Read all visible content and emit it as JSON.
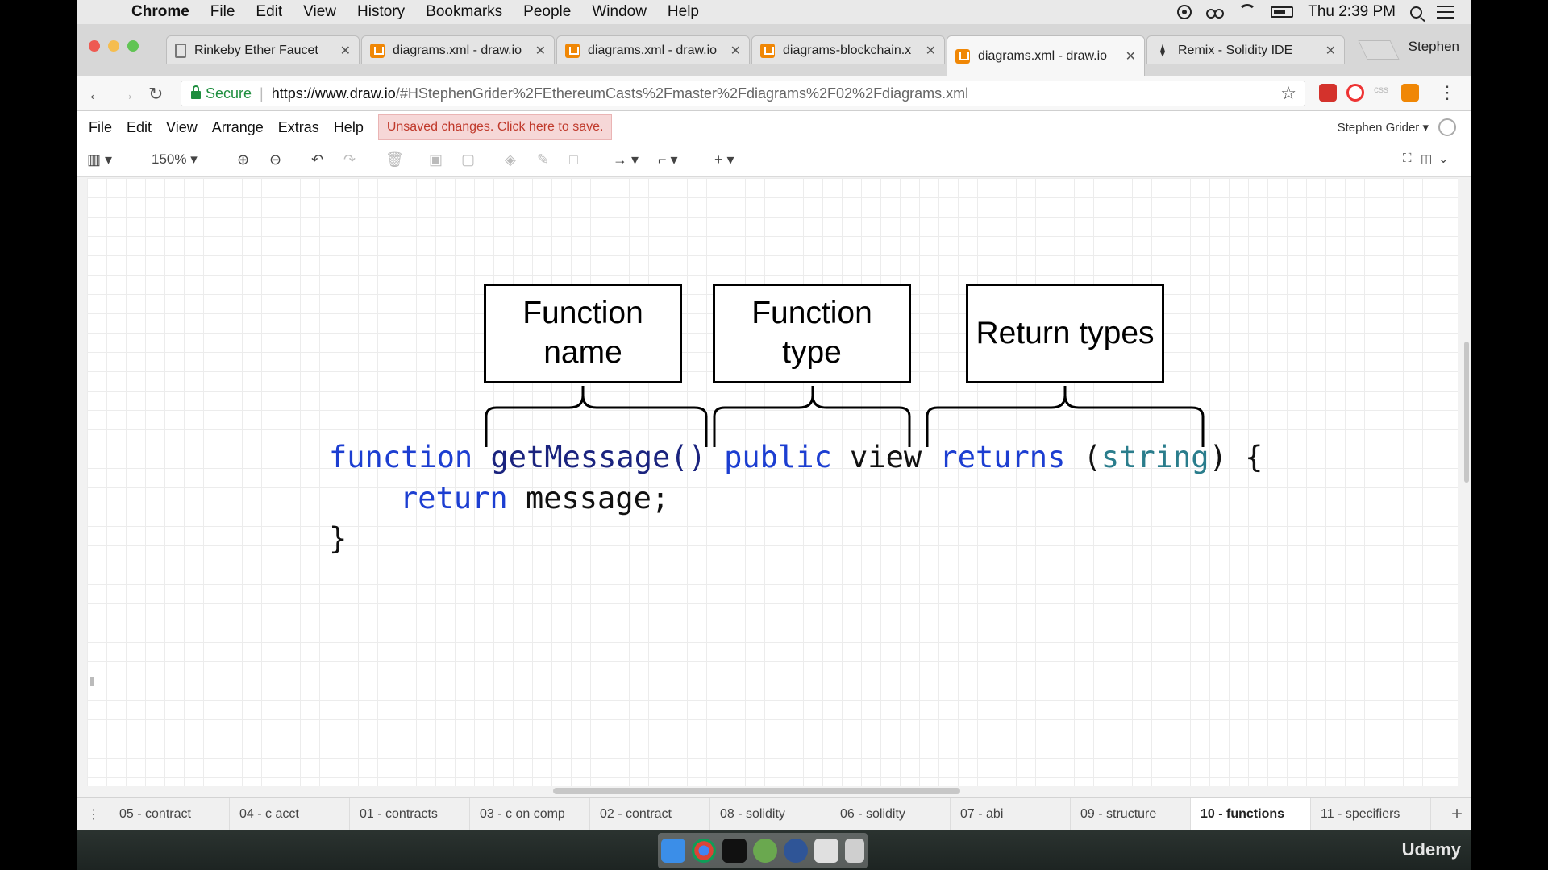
{
  "mac_menubar": {
    "apple_icon": "apple-icon",
    "items": [
      "Chrome",
      "File",
      "Edit",
      "View",
      "History",
      "Bookmarks",
      "People",
      "Window",
      "Help"
    ],
    "clock": "Thu 2:39 PM"
  },
  "browser": {
    "tabs": [
      {
        "label": "Rinkeby Ether Faucet",
        "icon": "document-icon"
      },
      {
        "label": "diagrams.xml - draw.io",
        "icon": "drawio-icon"
      },
      {
        "label": "diagrams.xml - draw.io",
        "icon": "drawio-icon"
      },
      {
        "label": "diagrams-blockchain.x",
        "icon": "drawio-icon"
      },
      {
        "label": "diagrams.xml - draw.io",
        "icon": "drawio-icon",
        "active": true
      },
      {
        "label": "Remix - Solidity IDE",
        "icon": "remix-icon"
      }
    ],
    "profile": "Stephen",
    "secure_label": "Secure",
    "url_host": "https://www.draw.io",
    "url_path": "/#HStephenGrider%2FEthereumCasts%2Fmaster%2Fdiagrams%2F02%2Fdiagrams.xml"
  },
  "drawio": {
    "menu": [
      "File",
      "Edit",
      "View",
      "Arrange",
      "Extras",
      "Help"
    ],
    "unsaved_notice": "Unsaved changes. Click here to save.",
    "user": "Stephen Grider",
    "zoom": "150%",
    "diagram": {
      "boxes": [
        "Function\nname",
        "Function\ntype",
        "Return types"
      ],
      "code": {
        "kw_function": "function",
        "fn_name": "getMessage()",
        "kw_public": "public",
        "kw_view": "view",
        "kw_returns": "returns",
        "paren_open": "(",
        "type_string": "string",
        "paren_close_brace": ") {",
        "kw_return": "return",
        "return_value": "message;",
        "closing_brace": "}"
      }
    },
    "pages": [
      "05 - contract",
      "04 - c acct",
      "01 - contracts",
      "03 - c on comp",
      "02 - contract",
      "08 - solidity",
      "06 - solidity",
      "07 - abi",
      "09 - structure",
      "10 - functions",
      "11 - specifiers"
    ],
    "active_page": "10 - functions"
  },
  "watermark": "Udemy"
}
